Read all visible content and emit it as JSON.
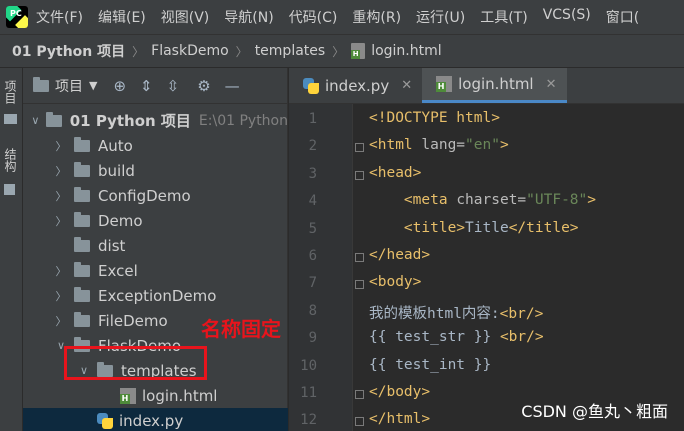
{
  "app": {
    "logo_text": "PC"
  },
  "menu": [
    "文件(F)",
    "编辑(E)",
    "视图(V)",
    "导航(N)",
    "代码(C)",
    "重构(R)",
    "运行(U)",
    "工具(T)",
    "VCS(S)",
    "窗口("
  ],
  "breadcrumb": [
    "01 Python 项目",
    "FlaskDemo",
    "templates",
    "login.html"
  ],
  "toolstrip": {
    "project_tab": "项目",
    "structure_tab": "结构"
  },
  "project_panel": {
    "title": "项目",
    "tree": [
      {
        "label": "01 Python 项目",
        "hint": "E:\\01 Python",
        "indent": 0,
        "expanded": true,
        "type": "folder",
        "bold": true
      },
      {
        "label": "Auto",
        "indent": 1,
        "expanded": false,
        "type": "folder"
      },
      {
        "label": "build",
        "indent": 1,
        "expanded": false,
        "type": "folder"
      },
      {
        "label": "ConfigDemo",
        "indent": 1,
        "expanded": false,
        "type": "folder"
      },
      {
        "label": "Demo",
        "indent": 1,
        "expanded": false,
        "type": "folder"
      },
      {
        "label": "dist",
        "indent": 1,
        "expanded": null,
        "type": "folder"
      },
      {
        "label": "Excel",
        "indent": 1,
        "expanded": false,
        "type": "folder"
      },
      {
        "label": "ExceptionDemo",
        "indent": 1,
        "expanded": false,
        "type": "folder"
      },
      {
        "label": "FileDemo",
        "indent": 1,
        "expanded": false,
        "type": "folder"
      },
      {
        "label": "FlaskDemo",
        "indent": 1,
        "expanded": true,
        "type": "folder"
      },
      {
        "label": "templates",
        "indent": 2,
        "expanded": true,
        "type": "folder"
      },
      {
        "label": "login.html",
        "indent": 3,
        "expanded": null,
        "type": "html"
      },
      {
        "label": "index.py",
        "indent": 2,
        "expanded": null,
        "type": "py",
        "selected": true
      }
    ]
  },
  "annotation": {
    "text": "名称固定"
  },
  "editor_tabs": [
    {
      "label": "index.py",
      "type": "py",
      "active": false
    },
    {
      "label": "login.html",
      "type": "html",
      "active": true
    }
  ],
  "editor": {
    "lines": [
      {
        "n": "1",
        "fold": false,
        "parts": [
          [
            "doctype",
            "<!DOCTYPE html>"
          ]
        ]
      },
      {
        "n": "2",
        "fold": true,
        "parts": [
          [
            "tag",
            "<html "
          ],
          [
            "attr",
            "lang="
          ],
          [
            "str",
            "\"en\""
          ],
          [
            "tag",
            ">"
          ]
        ]
      },
      {
        "n": "3",
        "fold": true,
        "parts": [
          [
            "tag",
            "<head>"
          ]
        ]
      },
      {
        "n": "4",
        "fold": false,
        "parts": [
          [
            "plain",
            "    "
          ],
          [
            "tag",
            "<meta "
          ],
          [
            "attr",
            "charset="
          ],
          [
            "str",
            "\"UTF-8\""
          ],
          [
            "tag",
            ">"
          ]
        ]
      },
      {
        "n": "5",
        "fold": false,
        "parts": [
          [
            "plain",
            "    "
          ],
          [
            "tag",
            "<title>"
          ],
          [
            "plain",
            "Title"
          ],
          [
            "tag",
            "</title>"
          ]
        ]
      },
      {
        "n": "6",
        "fold": true,
        "parts": [
          [
            "tag",
            "</head>"
          ]
        ]
      },
      {
        "n": "7",
        "fold": true,
        "parts": [
          [
            "tag",
            "<body>"
          ]
        ]
      },
      {
        "n": "8",
        "fold": false,
        "parts": [
          [
            "plain",
            "我的模板html内容:"
          ],
          [
            "tag",
            "<br/>"
          ]
        ]
      },
      {
        "n": "9",
        "fold": false,
        "parts": [
          [
            "plain",
            "{{ test_str }} "
          ],
          [
            "tag",
            "<br/>"
          ]
        ]
      },
      {
        "n": "10",
        "fold": false,
        "parts": [
          [
            "plain",
            "{{ test_int }}"
          ]
        ]
      },
      {
        "n": "11",
        "fold": true,
        "parts": [
          [
            "tag",
            "</body>"
          ]
        ]
      },
      {
        "n": "12",
        "fold": true,
        "parts": [
          [
            "tag",
            "</html>"
          ]
        ]
      }
    ]
  },
  "watermark": "CSDN @鱼丸丶粗面",
  "colors": {
    "tag": "#e8bf6a",
    "string": "#6a8759",
    "annotation": "#e8141c",
    "selection": "#0d293e",
    "tab_underline": "#4a88c7"
  }
}
